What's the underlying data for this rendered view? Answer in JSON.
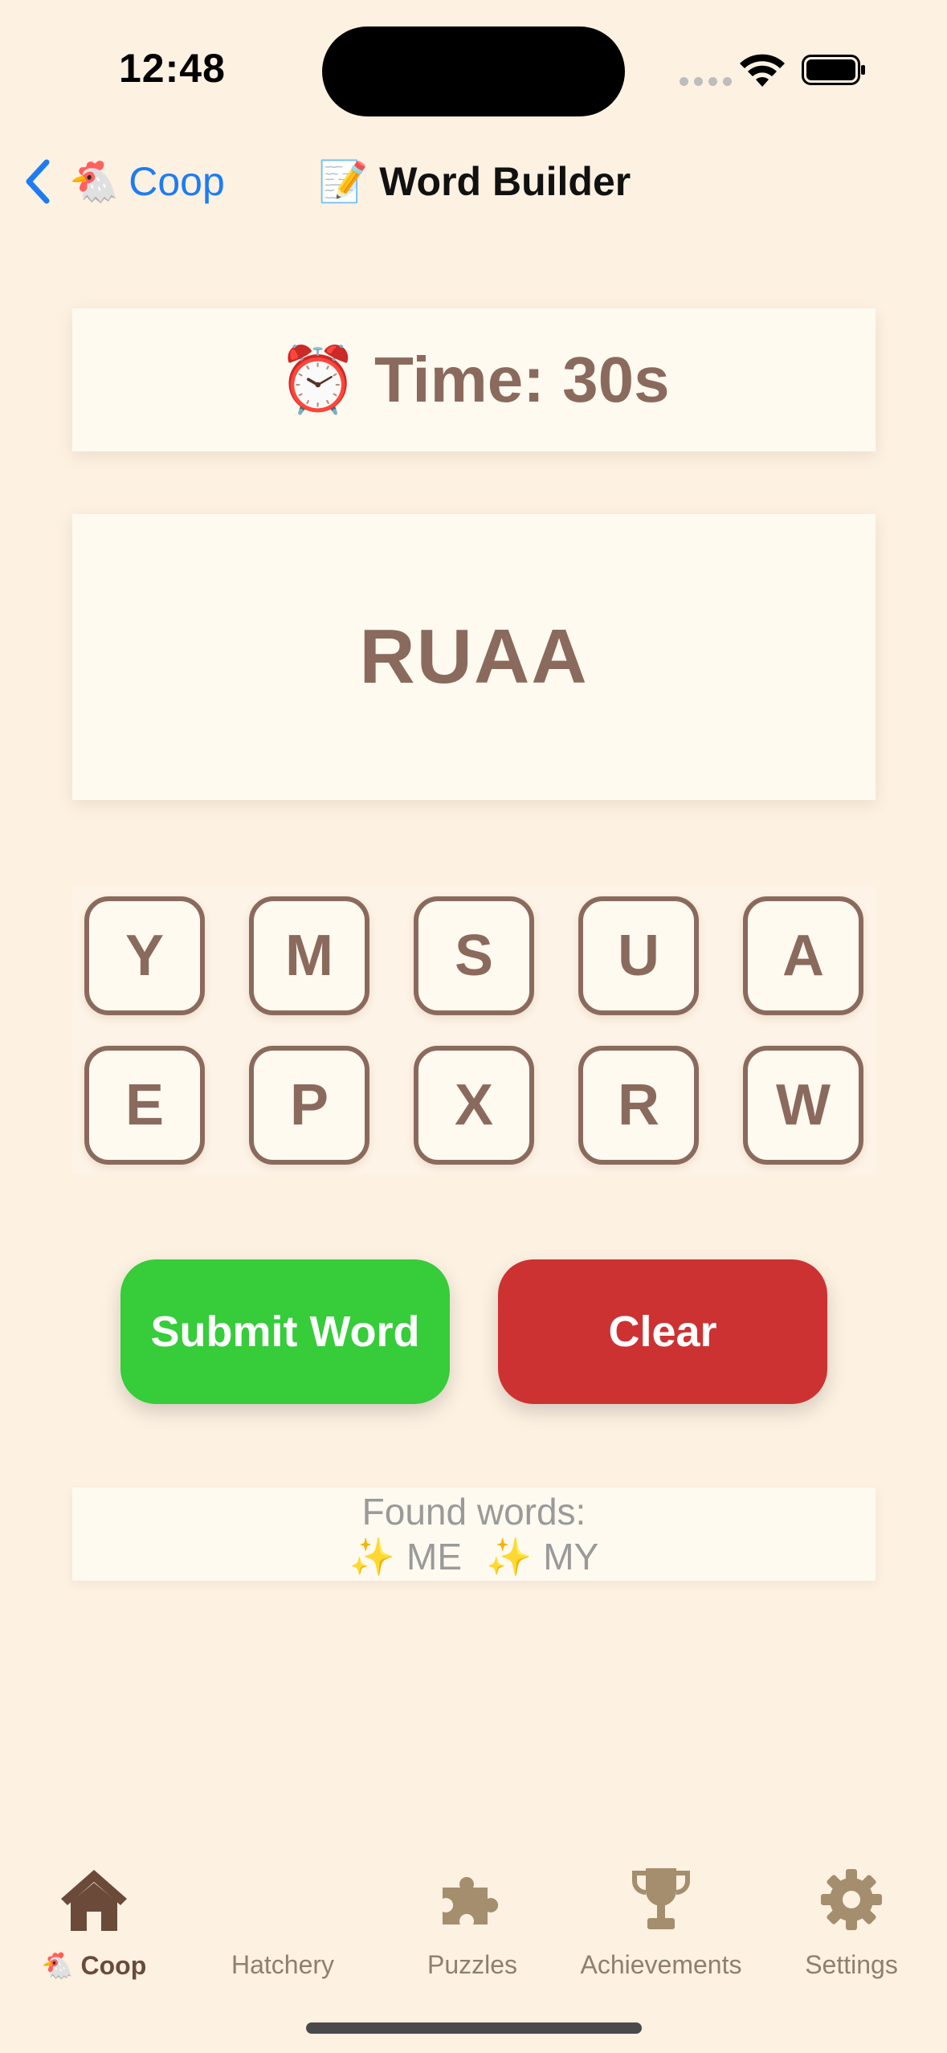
{
  "status_bar": {
    "time": "12:48"
  },
  "nav": {
    "back_label": "Coop",
    "back_emoji": "🐔",
    "title": "Word Builder",
    "title_emoji": "📝"
  },
  "timer": {
    "emoji": "⏰",
    "text": "Time: 30s"
  },
  "current_word": "RUAA",
  "tiles": [
    "Y",
    "M",
    "S",
    "U",
    "A",
    "E",
    "P",
    "X",
    "R",
    "W"
  ],
  "buttons": {
    "submit": "Submit Word",
    "clear": "Clear"
  },
  "found": {
    "label": "Found words:",
    "sparkle": "✨",
    "words": [
      "ME",
      "MY"
    ]
  },
  "tabs": [
    {
      "label": "Coop",
      "emoji": "🐔",
      "icon": "house-icon",
      "active": true
    },
    {
      "label": "Hatchery",
      "icon": "egg-icon",
      "active": false
    },
    {
      "label": "Puzzles",
      "icon": "puzzle-icon",
      "active": false
    },
    {
      "label": "Achievements",
      "icon": "trophy-icon",
      "active": false
    },
    {
      "label": "Settings",
      "icon": "gear-icon",
      "active": false
    }
  ],
  "colors": {
    "background": "#FDF1E2",
    "accent_brown": "#8B6A5E",
    "submit_green": "#36CC3A",
    "clear_red": "#CD3232",
    "link_blue": "#1E7CF2"
  }
}
